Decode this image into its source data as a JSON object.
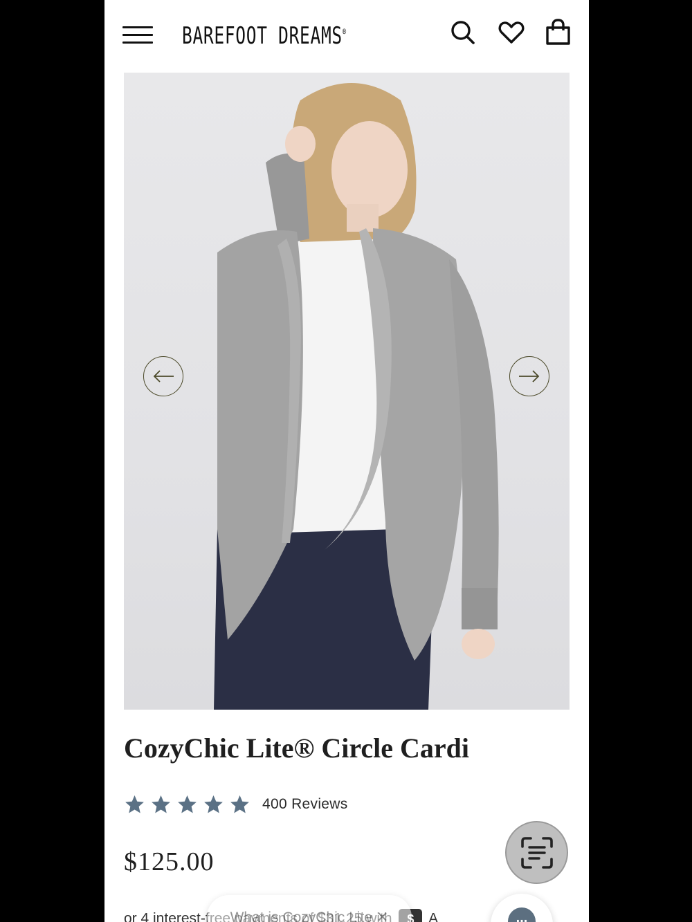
{
  "header": {
    "brand": "BAREFOOT DREAMS",
    "brand_mark": "®",
    "icons": [
      "menu-icon",
      "search-icon",
      "heart-icon",
      "shopping-bag-icon"
    ]
  },
  "gallery": {
    "image_alt": "",
    "prev_icon": "arrow-left-icon",
    "next_icon": "arrow-right-icon",
    "arrow_color": "#4c4a2a"
  },
  "product": {
    "title": "CozyChic Lite® Circle Cardi",
    "rating": 5,
    "rating_max": 5,
    "star_color": "#5b7185",
    "reviews_label": "400 Reviews",
    "price": "$125.00",
    "installments_prefix": "or 4 interest-free payments of $31.25 with",
    "afterpay_badge": "$",
    "installments_suffix": "A"
  },
  "overlays": {
    "toast_text": "What is CozyChic Lite ✕",
    "scan_icon": "text-scan-icon",
    "chat_icon": "chat-icon",
    "chat_text": "..."
  }
}
